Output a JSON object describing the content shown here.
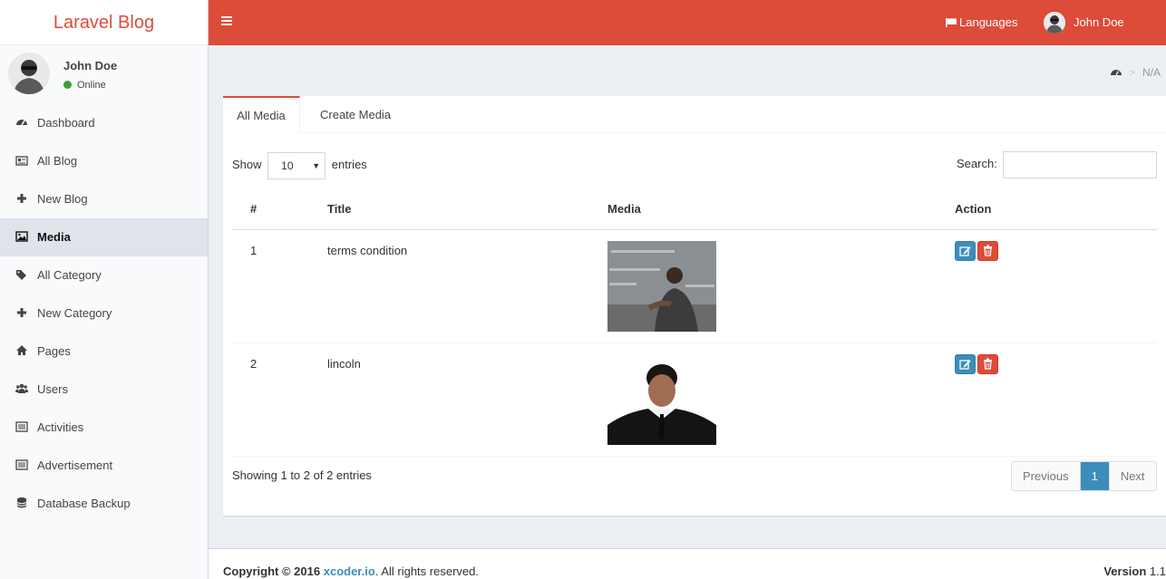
{
  "app": {
    "logo": "Laravel Blog"
  },
  "user": {
    "name": "John Doe",
    "status": "Online"
  },
  "sidebar": {
    "items": [
      {
        "label": "Dashboard",
        "icon": "dashboard-icon"
      },
      {
        "label": "All Blog",
        "icon": "newspaper-icon"
      },
      {
        "label": "New Blog",
        "icon": "plus-icon"
      },
      {
        "label": "Media",
        "icon": "image-icon",
        "active": true
      },
      {
        "label": "All Category",
        "icon": "tags-icon"
      },
      {
        "label": "New Category",
        "icon": "plus-icon"
      },
      {
        "label": "Pages",
        "icon": "home-icon"
      },
      {
        "label": "Users",
        "icon": "users-icon"
      },
      {
        "label": "Activities",
        "icon": "list-icon"
      },
      {
        "label": "Advertisement",
        "icon": "list-icon"
      },
      {
        "label": "Database Backup",
        "icon": "database-icon"
      }
    ]
  },
  "header": {
    "languages": "Languages",
    "user": "John Doe"
  },
  "breadcrumb": {
    "sep": ">",
    "current": "N/A"
  },
  "tabs": {
    "all": "All Media",
    "create": "Create Media"
  },
  "table_controls": {
    "show": "Show",
    "entries_value": "10",
    "entries": "entries",
    "search": "Search:"
  },
  "table": {
    "headers": [
      "#",
      "Title",
      "Media",
      "Action"
    ],
    "rows": [
      {
        "num": "1",
        "title": "terms condition"
      },
      {
        "num": "2",
        "title": "lincoln"
      }
    ]
  },
  "pagination": {
    "info": "Showing 1 to 2 of 2 entries",
    "prev": "Previous",
    "current": "1",
    "next": "Next"
  },
  "footer": {
    "copyright": "Copyright © 2016",
    "link": "xcoder.io",
    "rights": ". All rights reserved.",
    "version_label": "Version",
    "version": "1.1"
  },
  "colors": {
    "brand": "#dd4b39",
    "primary": "#3c8dbc",
    "sidebar_bg": "#f9fafc"
  }
}
